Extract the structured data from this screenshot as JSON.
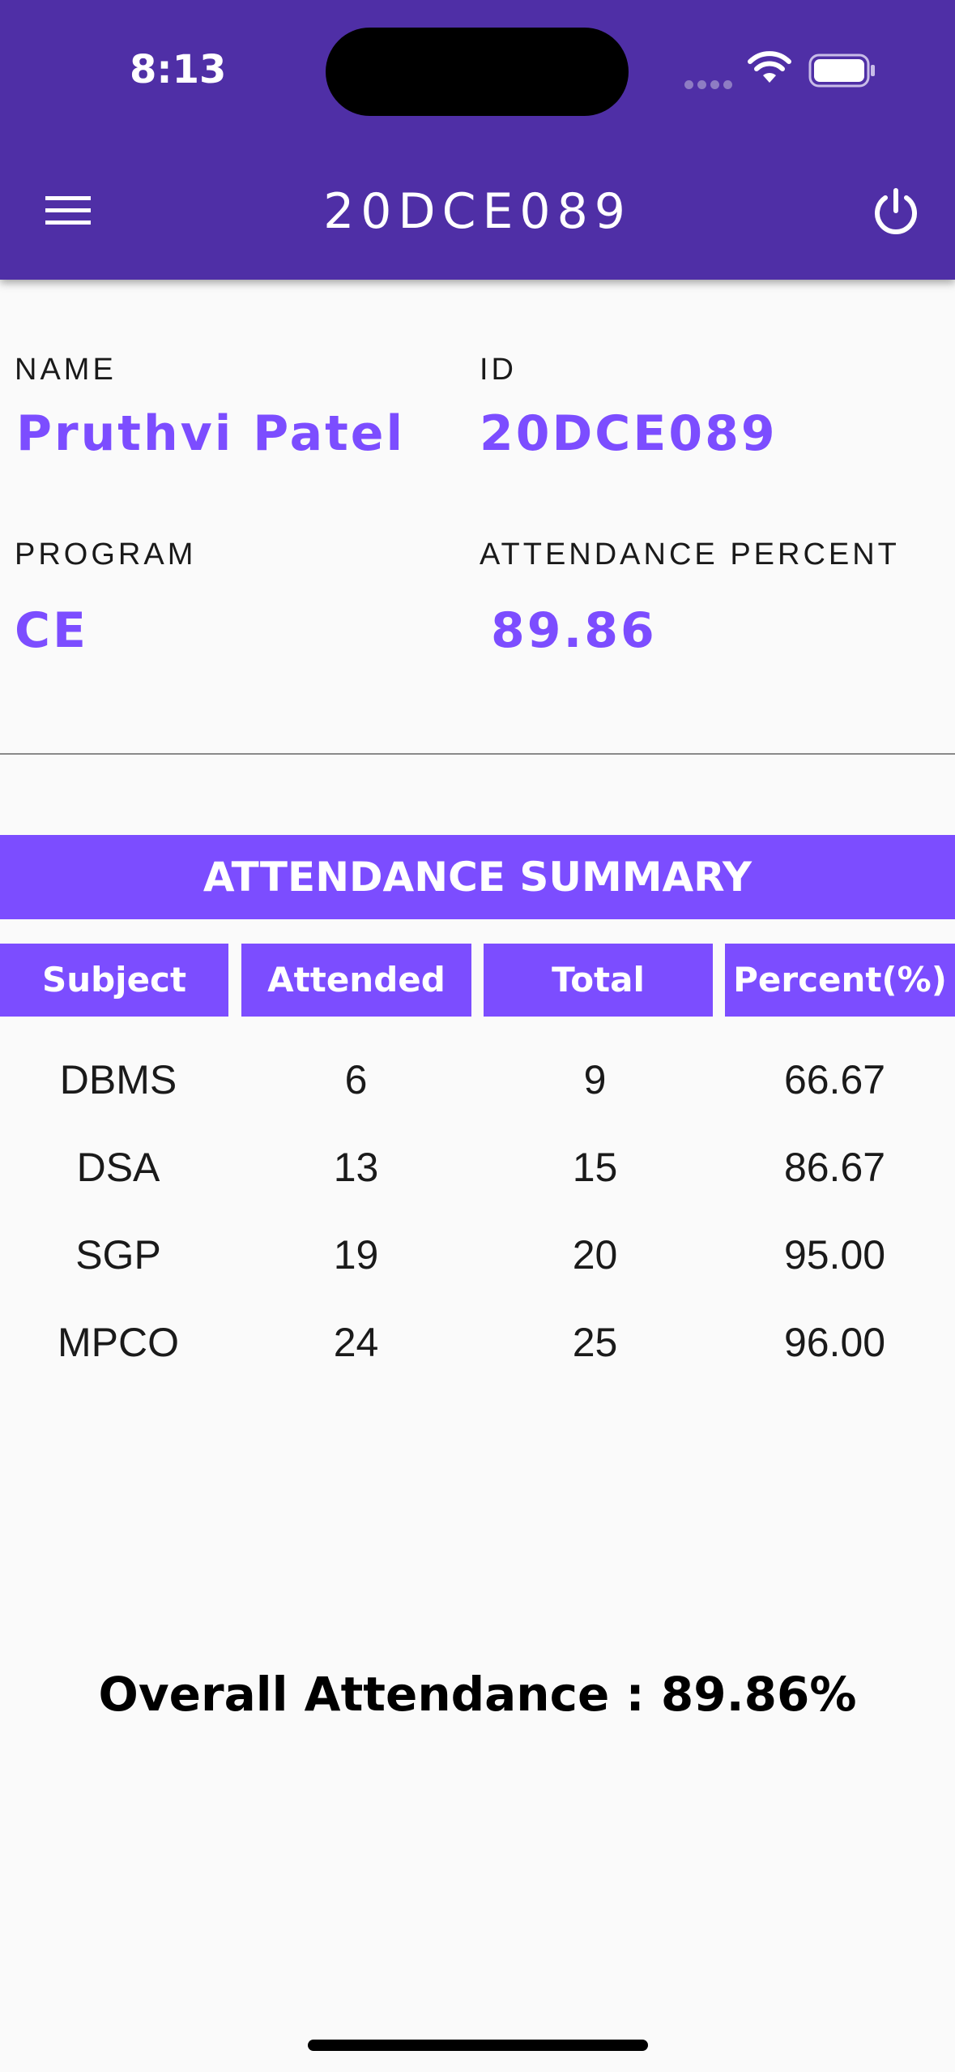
{
  "status_bar": {
    "time": "8:13"
  },
  "app_bar": {
    "title": "20DCE089",
    "menu_icon": "menu-icon",
    "power_icon": "power-icon"
  },
  "profile": {
    "name_label": "NAME",
    "name_value": "Pruthvi Patel",
    "id_label": "ID",
    "id_value": "20DCE089",
    "program_label": "PROGRAM",
    "program_value": "CE",
    "attendance_label": "ATTENDANCE PERCENT",
    "attendance_value": "89.86"
  },
  "summary": {
    "title": "ATTENDANCE SUMMARY",
    "headers": [
      "Subject",
      "Attended",
      "Total",
      "Percent(%)"
    ],
    "rows": [
      [
        "DBMS",
        "6",
        "9",
        "66.67"
      ],
      [
        "DSA",
        "13",
        "15",
        "86.67"
      ],
      [
        "SGP",
        "19",
        "20",
        "95.00"
      ],
      [
        "MPCO",
        "24",
        "25",
        "96.00"
      ]
    ]
  },
  "overall": "Overall Attendance :  89.86%",
  "colors": {
    "app_bar": "#4f2fa6",
    "accent": "#7c4dff"
  }
}
